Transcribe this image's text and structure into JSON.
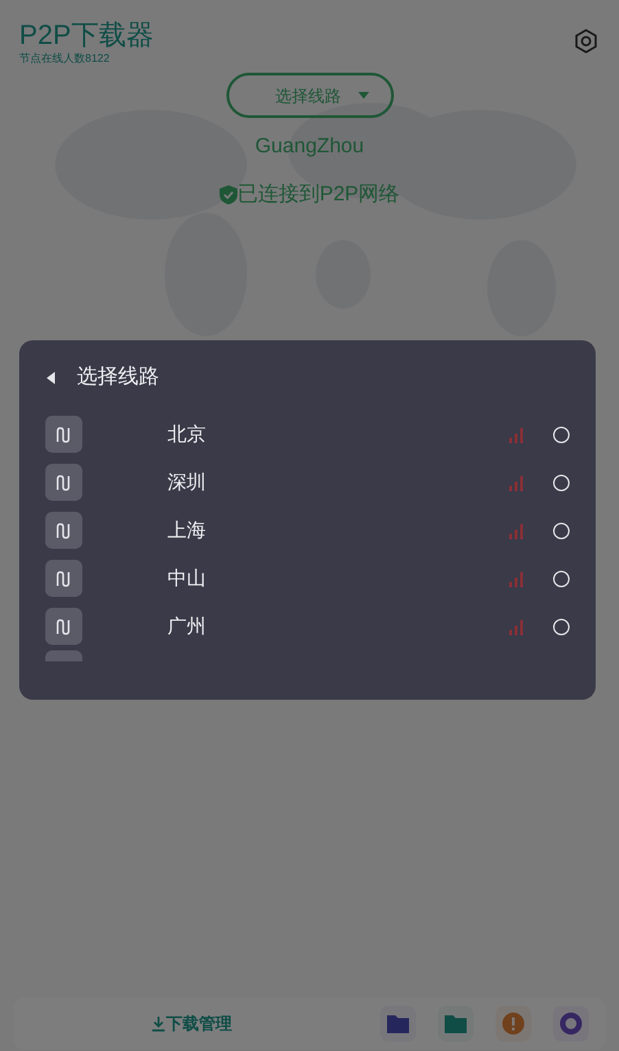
{
  "app": {
    "title": "P2P下载器",
    "subtitle": "节点在线人数8122"
  },
  "route_selector": {
    "label": "选择线路"
  },
  "location": "GuangZhou",
  "status": "已连接到P2P网络",
  "dialog": {
    "title": "选择线路",
    "routes": [
      {
        "name": "北京",
        "selected": false
      },
      {
        "name": "深圳",
        "selected": false
      },
      {
        "name": "上海",
        "selected": false
      },
      {
        "name": "中山",
        "selected": false
      },
      {
        "name": "广州",
        "selected": false
      }
    ]
  },
  "bottom_bar": {
    "download_label": "下载管理"
  }
}
